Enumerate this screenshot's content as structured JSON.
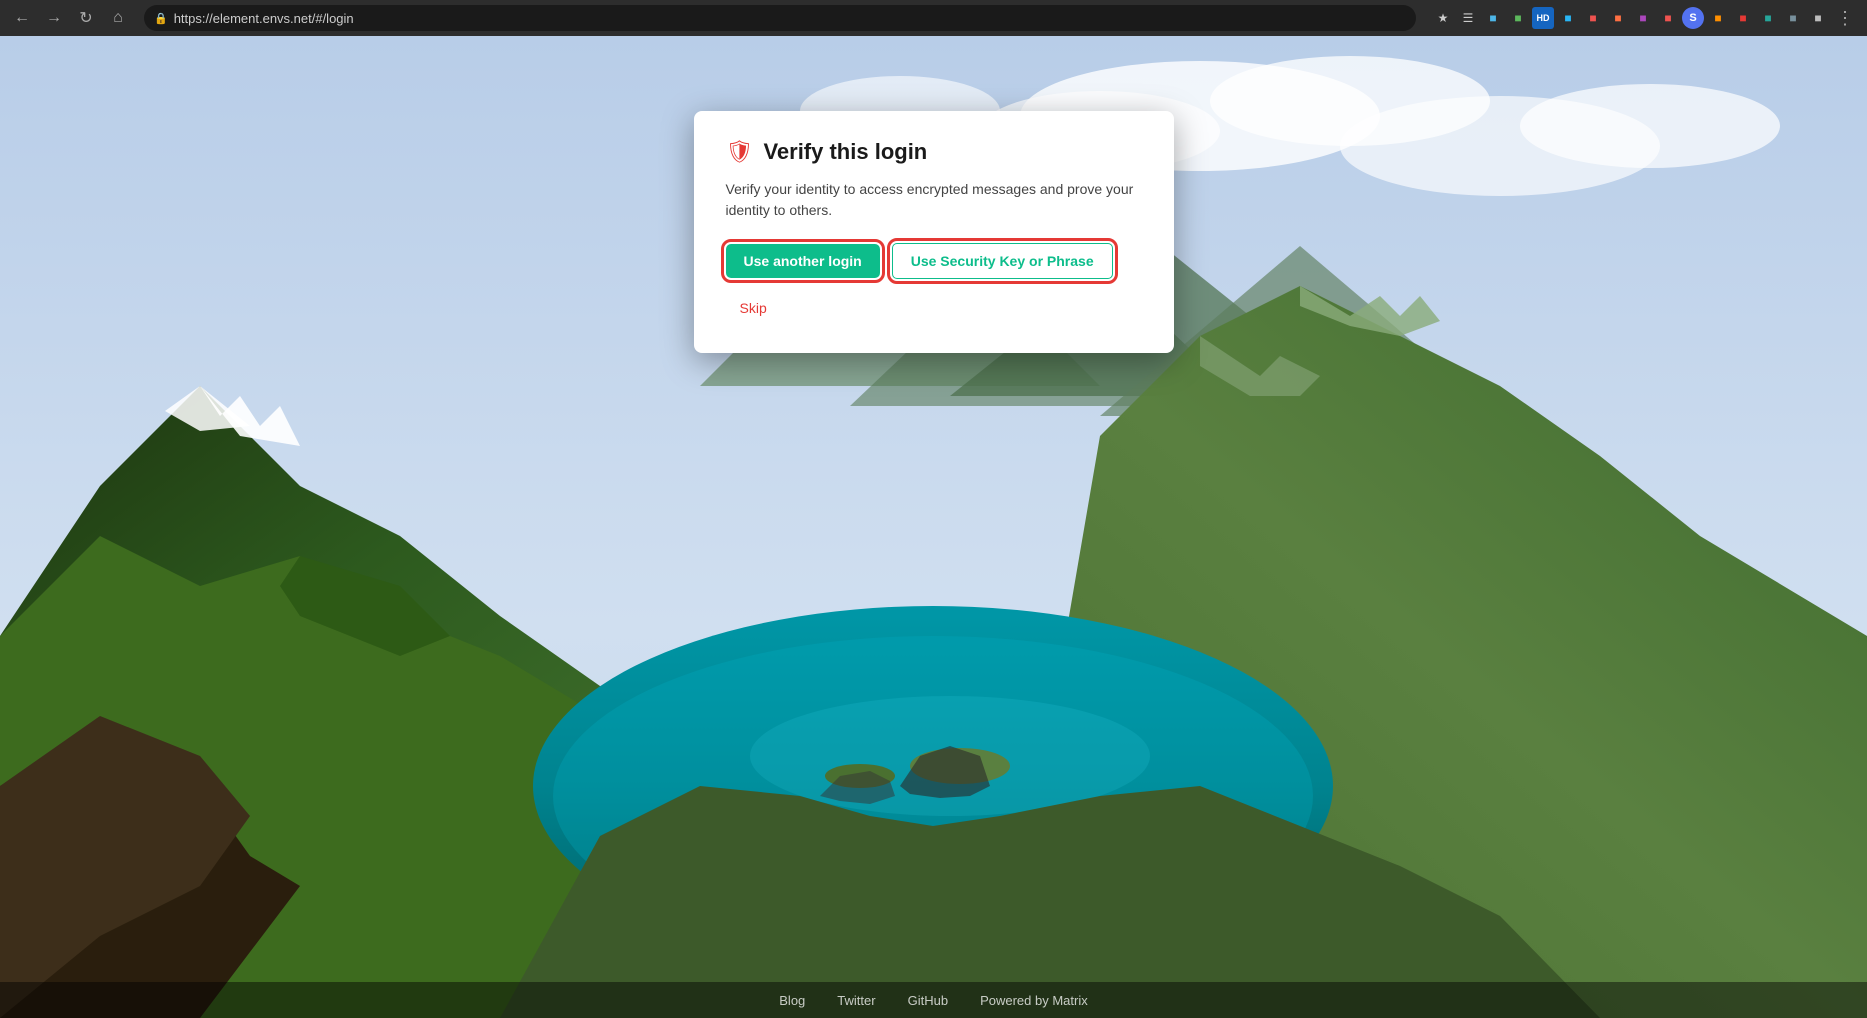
{
  "browser": {
    "url": "https://element.envs.net/#/login",
    "nav": {
      "back": "←",
      "forward": "→",
      "reload": "↻",
      "home": "⌂"
    }
  },
  "dialog": {
    "title": "Verify this login",
    "body": "Verify your identity to access encrypted messages and prove your identity to others.",
    "buttons": {
      "use_another": "Use another login",
      "security_key": "Use Security Key or Phrase",
      "skip": "Skip"
    }
  },
  "footer": {
    "links": [
      "Blog",
      "Twitter",
      "GitHub",
      "Powered by Matrix"
    ]
  }
}
